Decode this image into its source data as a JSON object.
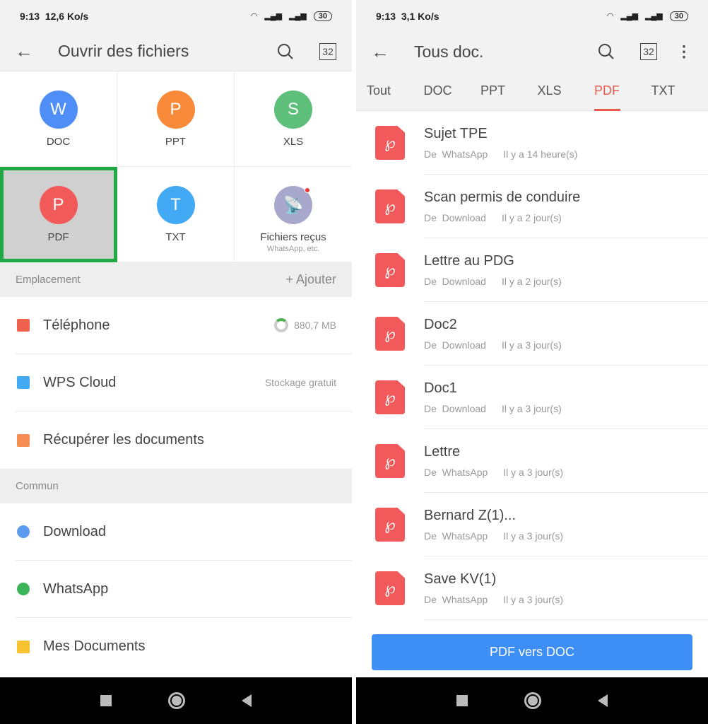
{
  "left": {
    "status": {
      "time": "9:13",
      "speed": "12,6 Ko/s",
      "battery": "30"
    },
    "header": {
      "title": "Ouvrir des fichiers",
      "tab_count": "32"
    },
    "grid": [
      {
        "label": "DOC",
        "glyph": "W",
        "color": "#4f8ef7"
      },
      {
        "label": "PPT",
        "glyph": "P",
        "color": "#f98a3a"
      },
      {
        "label": "XLS",
        "glyph": "S",
        "color": "#5dbf7a"
      },
      {
        "label": "PDF",
        "glyph": "P",
        "color": "#f25a5a",
        "selected": true
      },
      {
        "label": "TXT",
        "glyph": "T",
        "color": "#42a9f5"
      },
      {
        "label": "Fichiers reçus",
        "sub": "WhatsApp, etc.",
        "color": "#a8a8cc"
      }
    ],
    "location_section": {
      "title": "Emplacement",
      "add": "+ Ajouter"
    },
    "locations": [
      {
        "name": "Téléphone",
        "right": "880,7 MB",
        "icon": "phone-icon",
        "color": "#f0624d"
      },
      {
        "name": "WPS Cloud",
        "right": "Stockage gratuit",
        "icon": "cloud-icon",
        "color": "#42a9f5"
      },
      {
        "name": "Récupérer les documents",
        "right": "",
        "icon": "recover-folder-icon",
        "color": "#f58d55"
      }
    ],
    "common_section": {
      "title": "Commun"
    },
    "common": [
      {
        "name": "Download",
        "icon": "download-icon",
        "color": "#5c9df0"
      },
      {
        "name": "WhatsApp",
        "icon": "whatsapp-icon",
        "color": "#3cb55a"
      },
      {
        "name": "Mes Documents",
        "icon": "folder-icon",
        "color": "#f7c22f"
      }
    ]
  },
  "right": {
    "status": {
      "time": "9:13",
      "speed": "3,1 Ko/s",
      "battery": "30"
    },
    "header": {
      "title": "Tous doc.",
      "tab_count": "32"
    },
    "tabs": [
      "Tout",
      "DOC",
      "PPT",
      "XLS",
      "PDF",
      "TXT"
    ],
    "active_tab": "PDF",
    "files": [
      {
        "name": "Sujet TPE",
        "source": "De  WhatsApp",
        "time": "Il y a 14 heure(s)"
      },
      {
        "name": "Scan permis de conduire",
        "source": "De  Download",
        "time": "Il y a 2 jour(s)"
      },
      {
        "name": "Lettre au PDG",
        "source": "De  Download",
        "time": "Il y a 2 jour(s)"
      },
      {
        "name": "Doc2",
        "source": "De  Download",
        "time": "Il y a 3 jour(s)"
      },
      {
        "name": "Doc1",
        "source": "De  Download",
        "time": "Il y a 3 jour(s)"
      },
      {
        "name": "Lettre",
        "source": "De  WhatsApp",
        "time": "Il y a 3 jour(s)"
      },
      {
        "name": "Bernard Z(1)...",
        "source": "De  WhatsApp",
        "time": "Il y a 3 jour(s)"
      },
      {
        "name": "Save KV(1)",
        "source": "De  WhatsApp",
        "time": "Il y a 3 jour(s)"
      }
    ],
    "convert_button": "PDF vers DOC"
  },
  "colors": {
    "accent": "#e85a4f",
    "button": "#3d8ef5",
    "highlight": "#1fa843"
  }
}
